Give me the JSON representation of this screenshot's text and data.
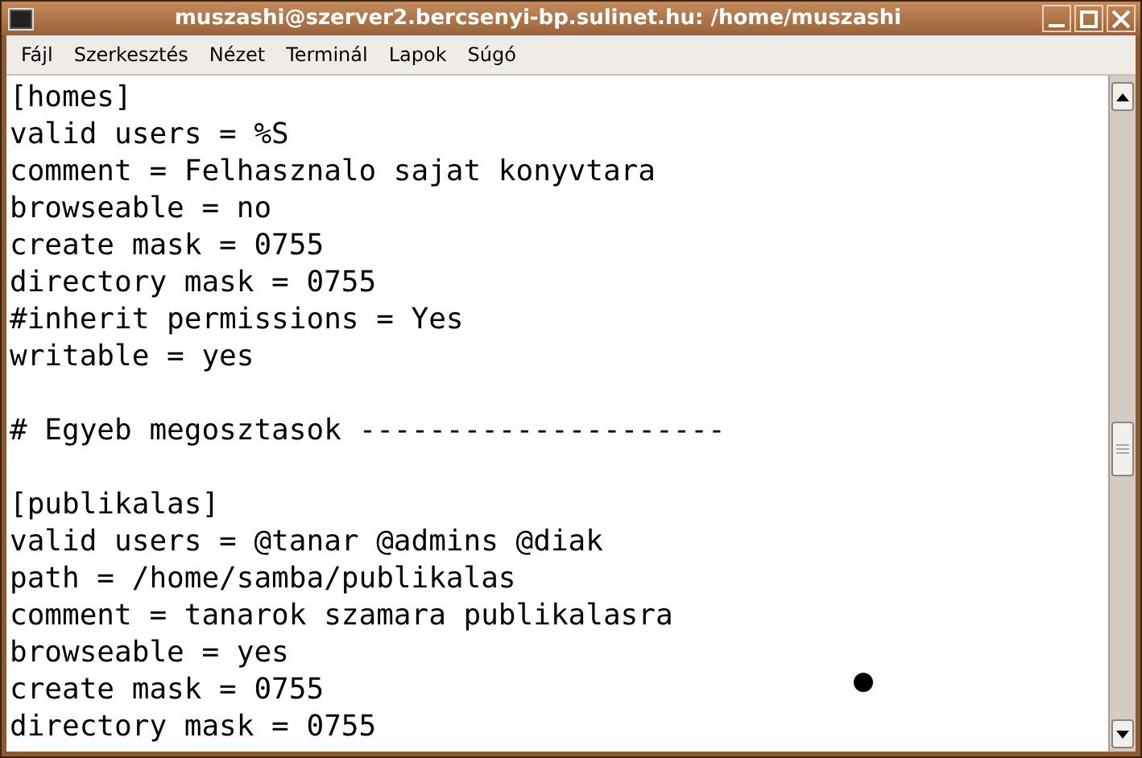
{
  "window": {
    "title": "muszashi@szerver2.bercsenyi-bp.sulinet.hu: /home/muszashi"
  },
  "menu": [
    "Fájl",
    "Szerkesztés",
    "Nézet",
    "Terminál",
    "Lapok",
    "Súgó"
  ],
  "terminal": {
    "lines": [
      {
        "kind": "text",
        "text": "[homes]"
      },
      {
        "kind": "text",
        "text": "valid users = %S"
      },
      {
        "kind": "text",
        "text": "comment = Felhasznalo sajat konyvtara"
      },
      {
        "kind": "text",
        "text": "browseable = no"
      },
      {
        "kind": "text",
        "text": "create mask = 0755"
      },
      {
        "kind": "text",
        "text": "directory mask = 0755"
      },
      {
        "kind": "text",
        "text": "#inherit permissions = Yes"
      },
      {
        "kind": "text",
        "text": "writable = yes"
      },
      {
        "kind": "blank"
      },
      {
        "kind": "text",
        "text": "# Egyeb megosztasok ---------------------"
      },
      {
        "kind": "blank"
      },
      {
        "kind": "text",
        "text": "[publikalas]"
      },
      {
        "kind": "text",
        "text": "valid users = @tanar @admins @diak"
      },
      {
        "kind": "text",
        "text": "path = /home/samba/publikalas"
      },
      {
        "kind": "text",
        "text": "comment = tanarok szamara publikalasra"
      },
      {
        "kind": "text",
        "text": "browseable = yes"
      },
      {
        "kind": "text",
        "text": "create mask = 0755"
      },
      {
        "kind": "text",
        "text": "directory mask = 0755"
      }
    ]
  }
}
